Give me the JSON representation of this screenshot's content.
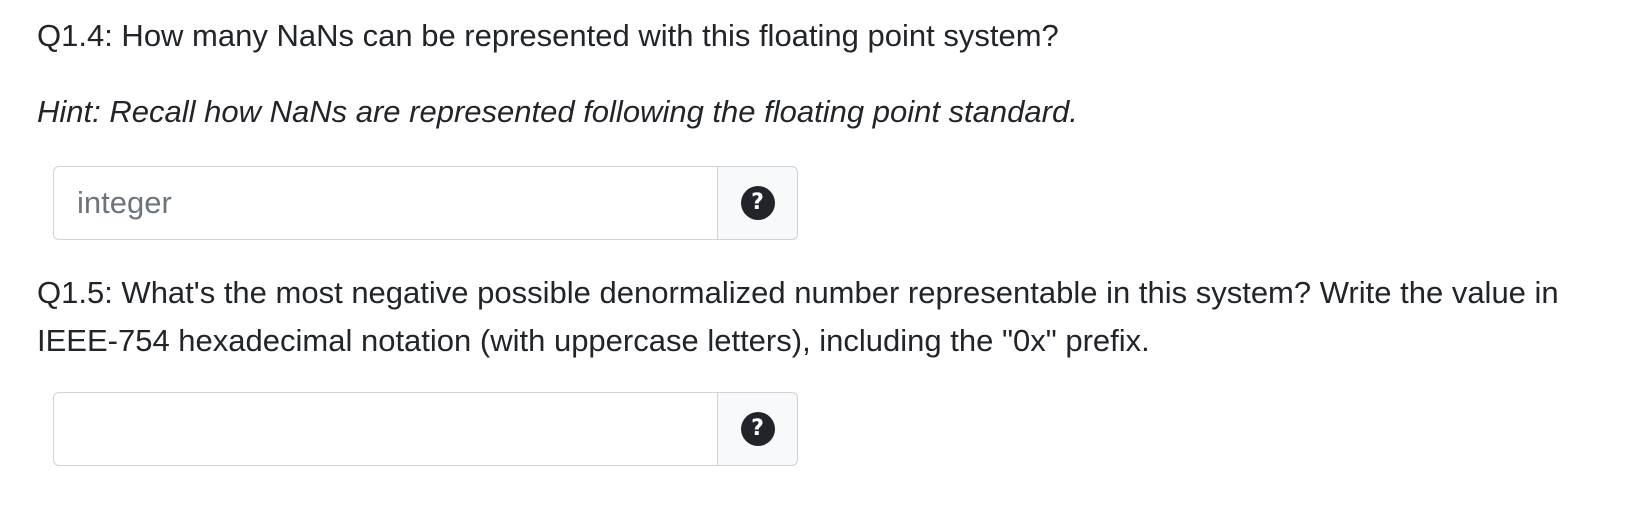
{
  "q14": {
    "text": "Q1.4: How many NaNs can be represented with this floating point system?",
    "hint": "Hint: Recall how NaNs are represented following the floating point standard.",
    "input_value": "",
    "input_placeholder": "integer",
    "help_icon": "question-circle-icon",
    "help_glyph": "?"
  },
  "q15": {
    "text": "Q1.5: What's the most negative possible denormalized number representable in this system? Write the value in IEEE-754 hexadecimal notation (with uppercase letters), including the \"0x\" prefix.",
    "input_value": "",
    "input_placeholder": "",
    "help_icon": "question-circle-icon",
    "help_glyph": "?"
  }
}
